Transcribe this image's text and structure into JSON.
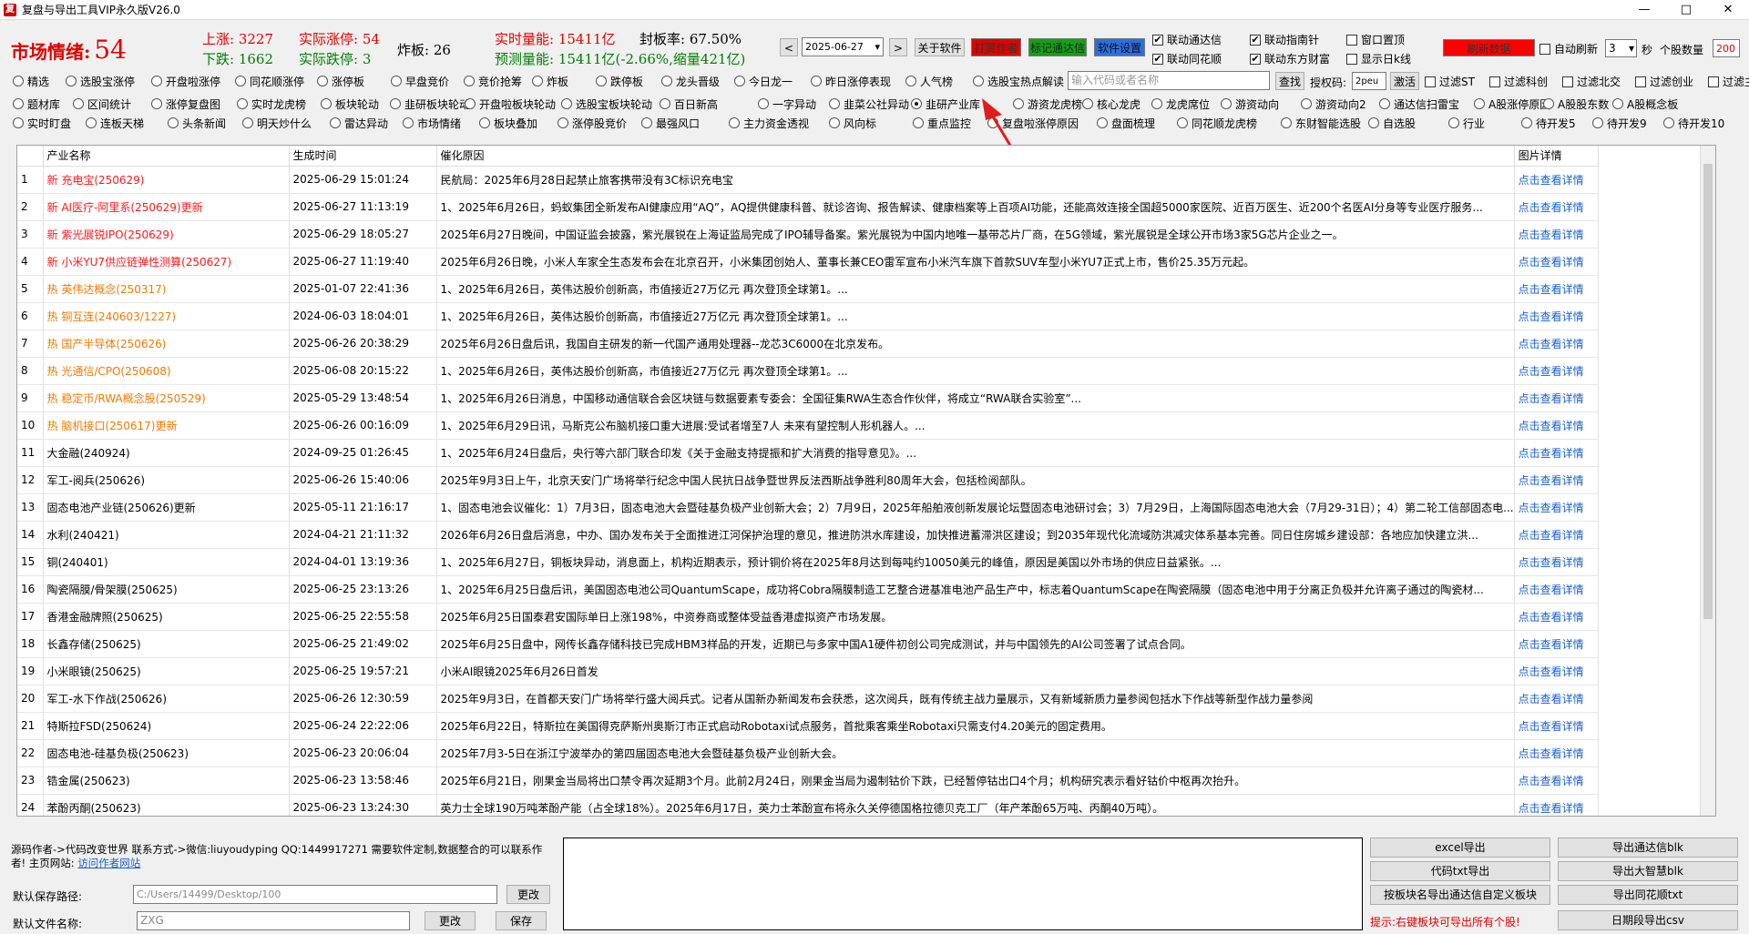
{
  "window": {
    "title": "复盘与导出工具VIP永久版V26.0",
    "min": "—",
    "max": "□",
    "close": "✕"
  },
  "stats": {
    "mood_label": "市场情绪:",
    "mood_value": "54",
    "up_label": "上涨:",
    "up": "3227",
    "zt_label": "实际涨停:",
    "zt": "54",
    "zb_label": "炸板:",
    "zb": "26",
    "down_label": "下跌:",
    "down": "1662",
    "dt_label": "实际跌停:",
    "dt": "3",
    "vol_label": "实时量能:",
    "vol": "15411亿",
    "fb_label": "封板率:",
    "fb": "67.50%",
    "pred_label": "预测量能:",
    "pred": "15411亿(-2.66%,缩量421亿)"
  },
  "toolbar": {
    "prev": "<",
    "date": "2025-06-27",
    "next": ">",
    "about": "关于软件",
    "reward": "打赏作者",
    "tdx": "标记通达信",
    "settings": "软件设置",
    "refresh": "刷新数据",
    "auto_refresh": "自动刷新",
    "interval": "3",
    "sec": "秒",
    "count_label": "个股数量",
    "count": "200"
  },
  "checks": [
    {
      "label": "联动通达信",
      "checked": true
    },
    {
      "label": "联动指南针",
      "checked": true
    },
    {
      "label": "窗口置顶",
      "checked": false
    },
    {
      "label": "联动同花顺",
      "checked": true
    },
    {
      "label": "联动东方财富",
      "checked": true
    },
    {
      "label": "显示日k线",
      "checked": false
    }
  ],
  "radios_row1": [
    "精选",
    "选股宝涨停",
    "开盘啦涨停",
    "同花顺涨停",
    "涨停板",
    "早盘竞价",
    "竞价抢筹",
    "炸板",
    "跌停板",
    "龙头晋级",
    "今日龙一",
    "昨日涨停表现",
    "人气榜",
    "选股宝热点解读"
  ],
  "search": {
    "placeholder": "输入代码或者名称",
    "button": "查找",
    "auth_label": "授权码:",
    "auth_value": "2peu",
    "activate": "激活"
  },
  "filters": [
    "过滤ST",
    "过滤科创",
    "过滤北交",
    "过滤创业",
    "过滤主板"
  ],
  "radios_row2": [
    "题材库",
    "区间统计",
    "涨停复盘图",
    "实时龙虎榜",
    "板块轮动",
    "韭研板块轮动",
    "开盘啦板块轮动",
    "选股宝板块轮动",
    "百日新高",
    "一字异动",
    "韭菜公社异动",
    "韭研产业库",
    "游资龙虎榜",
    "核心龙虎",
    "龙虎席位",
    "游资动向",
    "游资动向2",
    "通达信扫雷宝",
    "A股涨停原因",
    "A股股东数",
    "A股概念板"
  ],
  "radios_row3": [
    "实时盯盘",
    "连板天梯",
    "头条新闻",
    "明天炒什么",
    "雷达异动",
    "市场情绪",
    "板块叠加",
    "涨停股竞价",
    "最强风口",
    "主力资金透视",
    "风向标",
    "重点监控",
    "复盘啦涨停原因",
    "盘面梳理",
    "同花顺龙虎榜",
    "东财智能选股",
    "自选股",
    "行业",
    "待开发5",
    "待开发9",
    "待开发10"
  ],
  "selected_radio": "韭研产业库",
  "table": {
    "headers": [
      "",
      "产业名称",
      "生成时间",
      "催化原因",
      "图片详情"
    ],
    "rows": [
      {
        "n": "1",
        "name": "新 充电宝(250629)",
        "time": "2025-06-29 15:01:24",
        "reason": "民航局：2025年6月28日起禁止旅客携带没有3C标识充电宝",
        "link": "点击查看详情",
        "c": "red"
      },
      {
        "n": "2",
        "name": "新 AI医疗-阿里系(250629)更新",
        "time": "2025-06-27 11:13:19",
        "reason": "1、2025年6月26日，蚂蚁集团全新发布AI健康应用“AQ”，AQ提供健康科普、就诊咨询、报告解读、健康档案等上百项AI功能，还能高效连接全国超5000家医院、近百万医生、近200个名医AI分身等专业医疗服务...",
        "link": "点击查看详情",
        "c": "red"
      },
      {
        "n": "3",
        "name": "新 紫光展锐IPO(250629)",
        "time": "2025-06-29 18:05:27",
        "reason": "2025年6月27日晚间，中国证监会披露，紫光展锐在上海证监局完成了IPO辅导备案。紫光展锐为中国内地唯一基带芯片厂商，在5G领域，紫光展锐是全球公开市场3家5G芯片企业之一。",
        "link": "点击查看详情",
        "c": "red"
      },
      {
        "n": "4",
        "name": "新 小米YU7供应链弹性测算(250627)",
        "time": "2025-06-27 11:19:40",
        "reason": "2025年6月26日晚，小米人车家全生态发布会在北京召开，小米集团创始人、董事长兼CEO雷军宣布小米汽车旗下首款SUV车型小米YU7正式上市，售价25.35万元起。",
        "link": "点击查看详情",
        "c": "red"
      },
      {
        "n": "5",
        "name": "热 英伟达概念(250317)",
        "time": "2025-01-07 22:41:36",
        "reason": "1、2025年6月26日，英伟达股价创新高，市值接近27万亿元 再次登顶全球第1。...",
        "link": "点击查看详情",
        "c": "org"
      },
      {
        "n": "6",
        "name": "热 铜互连(240603/1227)",
        "time": "2024-06-03 18:04:01",
        "reason": "1、2025年6月26日，英伟达股价创新高，市值接近27万亿元 再次登顶全球第1。...",
        "link": "点击查看详情",
        "c": "org"
      },
      {
        "n": "7",
        "name": "热 国产半导体(250626)",
        "time": "2025-06-26 20:38:29",
        "reason": "2025年6月26日盘后讯，我国自主研发的新一代国产通用处理器--龙芯3C6000在北京发布。",
        "link": "点击查看详情",
        "c": "org"
      },
      {
        "n": "8",
        "name": "热 光通信/CPO(250608)",
        "time": "2025-06-08 20:15:22",
        "reason": "1、2025年6月26日，英伟达股价创新高，市值接近27万亿元 再次登顶全球第1。...",
        "link": "点击查看详情",
        "c": "org"
      },
      {
        "n": "9",
        "name": "热 稳定币/RWA概念股(250529)",
        "time": "2025-05-29 13:48:54",
        "reason": "1、2025年6月26日消息，中国移动通信联合会区块链与数据要素专委会：全国征集RWA生态合作伙伴，将成立“RWA联合实验室”...",
        "link": "点击查看详情",
        "c": "org"
      },
      {
        "n": "10",
        "name": "热 脑机接口(250617)更新",
        "time": "2025-06-26 00:16:09",
        "reason": "1、2025年6月29日讯，马斯克公布脑机接口重大进展:受试者增至7人 未来有望控制人形机器人。...",
        "link": "点击查看详情",
        "c": "org"
      },
      {
        "n": "11",
        "name": "大金融(240924)",
        "time": "2024-09-25 01:26:45",
        "reason": "1、2025年6月24日盘后，央行等六部门联合印发《关于金融支持提振和扩大消费的指导意见》。...",
        "link": "点击查看详情",
        "c": ""
      },
      {
        "n": "12",
        "name": "军工-阅兵(250626)",
        "time": "2025-06-26 15:40:06",
        "reason": "2025年9月3日上午，北京天安门广场将举行纪念中国人民抗日战争暨世界反法西斯战争胜利80周年大会，包括检阅部队。",
        "link": "点击查看详情",
        "c": ""
      },
      {
        "n": "13",
        "name": "固态电池产业链(250626)更新",
        "time": "2025-05-11 21:16:17",
        "reason": "1、固态电池会议催化：1）7月3日，固态电池大会暨硅基负极产业创新大会；2）7月9日，2025年船舶液创新发展论坛暨固态电池研讨会；3）7月29日，上海国际固态电池大会（7月29-31日）；4）第二轮工信部固态电...",
        "link": "点击查看详情",
        "c": ""
      },
      {
        "n": "14",
        "name": "水利(240421)",
        "time": "2024-04-21 21:11:32",
        "reason": "2026年6月26日盘后消息，中办、国办发布关于全面推进江河保护治理的意见，推进防洪水库建设，加快推进蓄滞洪区建设；到2035年现代化流域防洪减灾体系基本完善。同日住房城乡建设部：各地应加快建立洪...",
        "link": "点击查看详情",
        "c": ""
      },
      {
        "n": "15",
        "name": "铜(240401)",
        "time": "2024-04-01 13:19:36",
        "reason": "1、2025年6月27日，铜板块异动，消息面上，机构近期表示，预计铜价将在2025年8月达到每吨约10050美元的峰值，原因是美国以外市场的供应日益紧张。...",
        "link": "点击查看详情",
        "c": ""
      },
      {
        "n": "16",
        "name": "陶瓷隔膜/骨架膜(250625)",
        "time": "2025-06-25 23:13:26",
        "reason": "1、2025年6月25日盘后讯，美国固态电池公司QuantumScape，成功将Cobra隔膜制造工艺整合进基准电池产品生产中，标志着QuantumScape在陶瓷隔膜（固态电池中用于分离正负极并允许离子通过的陶瓷材...",
        "link": "点击查看详情",
        "c": ""
      },
      {
        "n": "17",
        "name": "香港金融牌照(250625)",
        "time": "2025-06-25 22:55:58",
        "reason": "2025年6月25日国泰君安国际单日上涨198%，中资券商或整体受益香港虚拟资产市场发展。",
        "link": "点击查看详情",
        "c": ""
      },
      {
        "n": "18",
        "name": "长鑫存储(250625)",
        "time": "2025-06-25 21:49:02",
        "reason": "2025年6月25日盘中，网传长鑫存储科技已完成HBM3样品的开发，近期已与多家中国A1硬件初创公司完成测试，并与中国领先的AI公司签署了试点合同。",
        "link": "点击查看详情",
        "c": ""
      },
      {
        "n": "19",
        "name": "小米眼镜(250625)",
        "time": "2025-06-25 19:57:21",
        "reason": "小米AI眼镜2025年6月26日首发",
        "link": "点击查看详情",
        "c": ""
      },
      {
        "n": "20",
        "name": "军工-水下作战(250626)",
        "time": "2025-06-26 12:30:59",
        "reason": "2025年9月3日，在首都天安门广场将举行盛大阅兵式。记者从国新办新闻发布会获悉，这次阅兵，既有传统主战力量展示，又有新域新质力量参阅包括水下作战等新型作战力量参阅",
        "link": "点击查看详情",
        "c": ""
      },
      {
        "n": "21",
        "name": "特斯拉FSD(250624)",
        "time": "2025-06-24 22:22:06",
        "reason": "2025年6月22日，特斯拉在美国得克萨斯州奥斯汀市正式启动Robotaxi试点服务，首批乘客乘坐Robotaxi只需支付4.20美元的固定费用。",
        "link": "点击查看详情",
        "c": ""
      },
      {
        "n": "22",
        "name": "固态电池-硅基负极(250623)",
        "time": "2025-06-23 20:06:04",
        "reason": "2025年7月3-5日在浙江宁波举办的第四届固态电池大会暨硅基负极产业创新大会。",
        "link": "点击查看详情",
        "c": ""
      },
      {
        "n": "23",
        "name": "锆金属(250623)",
        "time": "2025-06-23 13:58:46",
        "reason": "2025年6月21日，刚果金当局将出口禁令再次延期3个月。此前2月24日，刚果金当局为遏制钴价下跌，已经暂停钴出口4个月；机构研究表示看好钴价中枢再次抬升。",
        "link": "点击查看详情",
        "c": ""
      },
      {
        "n": "24",
        "name": "苯酚丙酮(250623)",
        "time": "2025-06-23 13:24:30",
        "reason": "英力士全球190万吨苯酚产能（占全球18%）。2025年6月17日，英力士苯酚宣布将永久关停德国格拉德贝克工厂（年产苯酚65万吨、丙酮40万吨）。",
        "link": "点击查看详情",
        "c": ""
      }
    ]
  },
  "footer": {
    "author_line1": "源码作者->代码改变世界 联系方式->微信:liuyoudyping QQ:1449917271 需要软件定制,数据整合的可以联系作",
    "author_line2": "者! 主页网站:",
    "site_link": "访问作者网站",
    "save_path_label": "默认保存路径:",
    "save_path": "C:/Users/14499/Desktop/100",
    "change": "更改",
    "file_name_label": "默认文件名称:",
    "file_name": "ZXG",
    "change2": "更改",
    "save": "保存",
    "excel": "excel导出",
    "tdx_blk": "导出通达信blk",
    "code_txt": "代码txt导出",
    "dzh_blk": "导出大智慧blk",
    "by_block": "按板块名导出通达信自定义板块",
    "ths_txt": "导出同花顺txt",
    "tip": "提示:右键板块可导出所有个股!",
    "csv": "日期段导出csv"
  }
}
